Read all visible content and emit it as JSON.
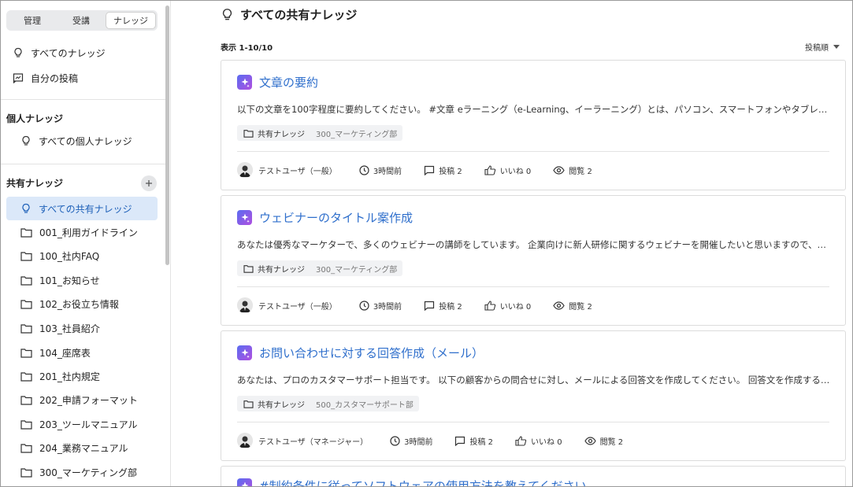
{
  "sidebar": {
    "tabs": [
      "管理",
      "受講",
      "ナレッジ"
    ],
    "active_tab": 2,
    "top_items": [
      {
        "label": "すべてのナレッジ",
        "icon": "lightbulb-icon"
      },
      {
        "label": "自分の投稿",
        "icon": "post-icon"
      }
    ],
    "personal": {
      "title": "個人ナレッジ",
      "items": [
        {
          "label": "すべての個人ナレッジ",
          "icon": "lightbulb-icon"
        }
      ]
    },
    "shared": {
      "title": "共有ナレッジ",
      "add_icon": "plus-icon",
      "items": [
        {
          "label": "すべての共有ナレッジ",
          "icon": "lightbulb-icon",
          "active": true
        },
        {
          "label": "001_利用ガイドライン",
          "icon": "folder-icon"
        },
        {
          "label": "100_社内FAQ",
          "icon": "folder-icon"
        },
        {
          "label": "101_お知らせ",
          "icon": "folder-icon"
        },
        {
          "label": "102_お役立ち情報",
          "icon": "folder-icon"
        },
        {
          "label": "103_社員紹介",
          "icon": "folder-icon"
        },
        {
          "label": "104_座席表",
          "icon": "folder-icon"
        },
        {
          "label": "201_社内規定",
          "icon": "folder-icon"
        },
        {
          "label": "202_申請フォーマット",
          "icon": "folder-icon"
        },
        {
          "label": "203_ツールマニュアル",
          "icon": "folder-icon"
        },
        {
          "label": "204_業務マニュアル",
          "icon": "folder-icon"
        },
        {
          "label": "300_マーケティング部",
          "icon": "folder-icon"
        }
      ]
    }
  },
  "main": {
    "title": "すべての共有ナレッジ",
    "count_label": "表示 1-10/10",
    "sort_label": "投稿順",
    "cards": [
      {
        "title": "文章の要約",
        "desc": "以下の文章を100字程度に要約してください。 #文章 eラーニング（e-Learning、イーラーニング）とは、パソコン、スマートフォンやタブレットなどを使って学ぶ学習形態のことです。",
        "tag": "共有ナレッジ",
        "tag_sub": "300_マーケティング部",
        "user": "テストユーザ（一般）",
        "time": "3時間前",
        "posts": "投稿 2",
        "likes": "いいね 0",
        "views": "閲覧 2"
      },
      {
        "title": "ウェビナーのタイトル案作成",
        "desc": "あなたは優秀なマーケターで、多くのウェビナーの講師をしています。 企業向けに新人研修に関するウェビナーを開催したいと思いますので、タイトル案を考えてください。",
        "tag": "共有ナレッジ",
        "tag_sub": "300_マーケティング部",
        "user": "テストユーザ（一般）",
        "time": "3時間前",
        "posts": "投稿 2",
        "likes": "いいね 0",
        "views": "閲覧 2"
      },
      {
        "title": "お問い合わせに対する回答作成（メール）",
        "desc": "あなたは、プロのカスタマーサポート担当です。 以下の顧客からの問合せに対し、メールによる回答文を作成してください。 回答文を作成する際には丁寧な言葉遣いを心がけてください。",
        "tag": "共有ナレッジ",
        "tag_sub": "500_カスタマーサポート部",
        "user": "テストユーザ（マネージャー）",
        "time": "3時間前",
        "posts": "投稿 2",
        "likes": "いいね 0",
        "views": "閲覧 2"
      },
      {
        "title": "#制約条件に従ってソフトウェアの使用方法を教えてください"
      }
    ]
  }
}
